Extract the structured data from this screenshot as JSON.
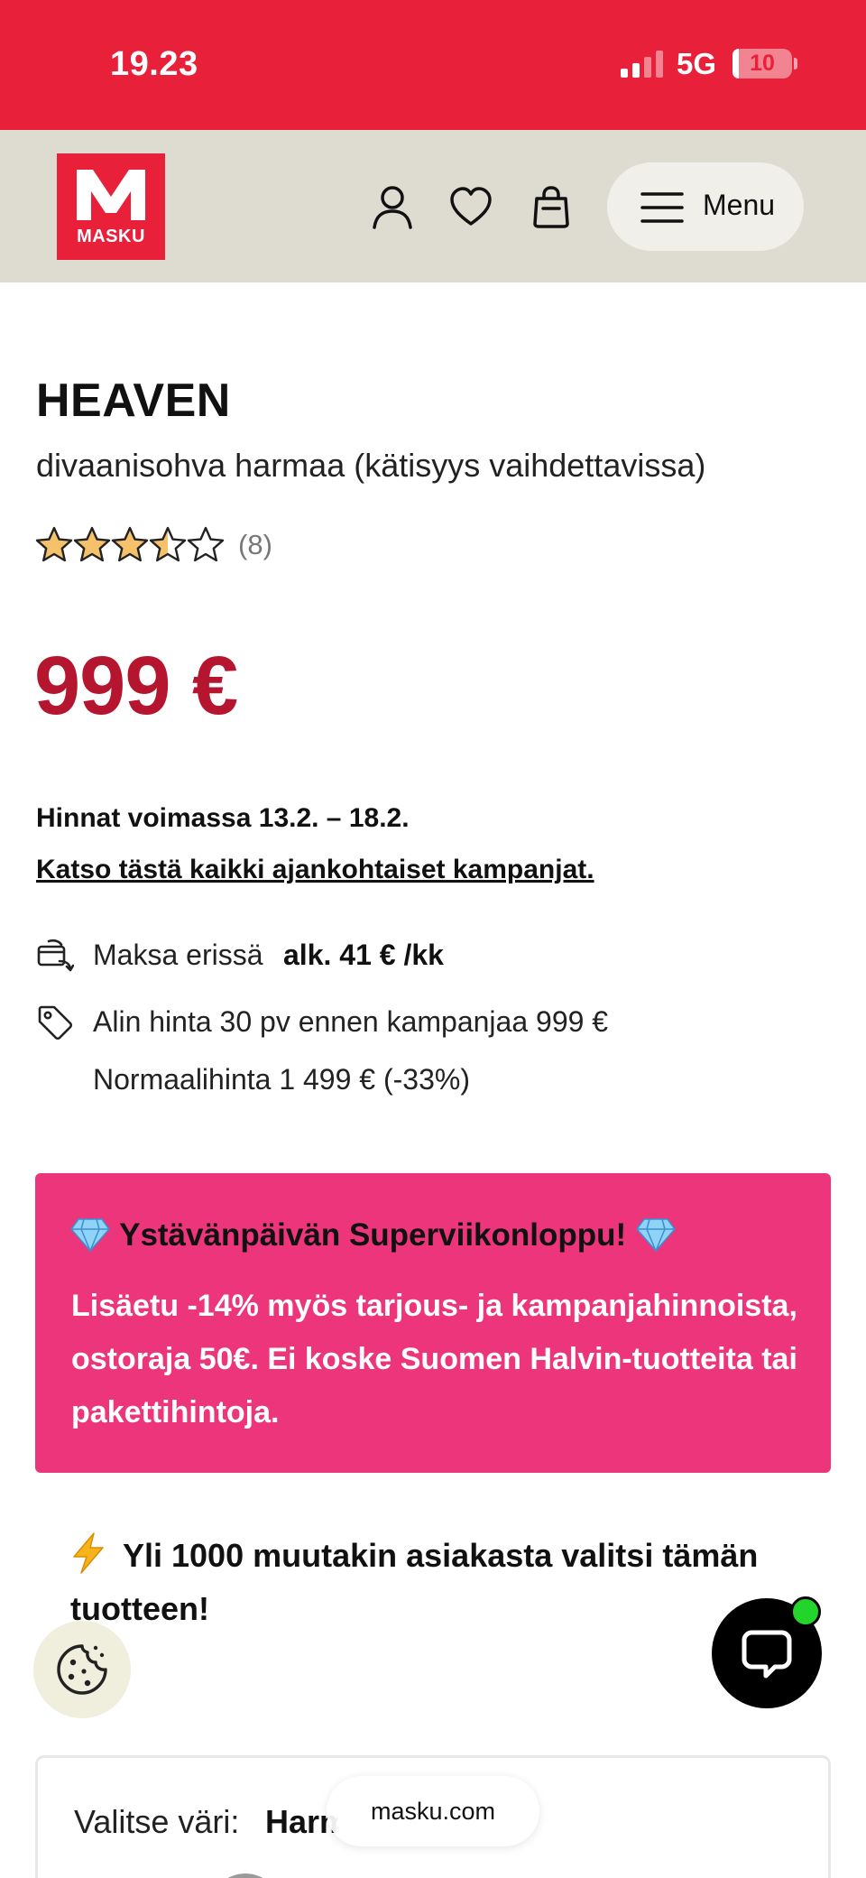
{
  "status_bar": {
    "time": "19.23",
    "network": "5G",
    "battery": "10",
    "battery_level": 0.1
  },
  "header": {
    "logo_text": "MASKU",
    "menu_label": "Menu"
  },
  "product": {
    "title": "HEAVEN",
    "subtitle": "divaanisohva harmaa (kätisyys vaihdettavissa)",
    "rating": 3.5,
    "rating_max": 5,
    "review_count": "(8)",
    "price": "999 €"
  },
  "campaign": {
    "validity": "Hinnat voimassa 13.2. – 18.2.",
    "link_text": "Katso tästä kaikki ajankohtaiset kampanjat."
  },
  "info": {
    "installment_label": "Maksa erissä",
    "installment_value": "alk. 41 € /kk",
    "lowest_price": "Alin hinta 30 pv ennen kampanjaa 999 €",
    "normal_price": "Normaalihinta 1 499 € (-33%)"
  },
  "promo": {
    "title": "Ystävänpäivän Superviikonloppu!",
    "body": "Lisäetu -14% myös tarjous- ja kampanjahinnoista, ostoraja 50€. Ei koske Suomen Halvin-tuotteita tai pakettihintoja.",
    "background": "#ec357a"
  },
  "social_proof": {
    "text": "Yli 1000 muutakin asiakasta valitsi tämän tuotteen!"
  },
  "color_selector": {
    "label": "Valitse väri:",
    "value": "Harmaa"
  },
  "browser": {
    "url": "masku.com"
  },
  "colors": {
    "brand_red": "#e8203a",
    "price_red": "#b5152e",
    "header_bg": "#dedbd0",
    "chat_online": "#23d42b"
  },
  "icons": [
    "user-icon",
    "heart-icon",
    "bag-icon",
    "hamburger-icon",
    "star-icon",
    "installment-icon",
    "price-tag-icon",
    "gem-icon",
    "lightning-icon",
    "cookie-icon",
    "chat-icon"
  ]
}
